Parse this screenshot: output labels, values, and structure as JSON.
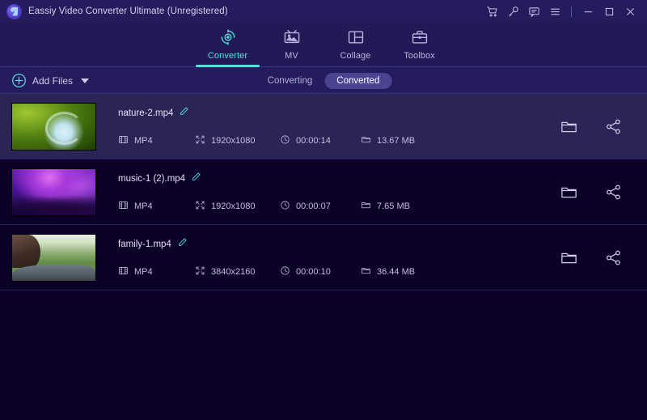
{
  "window": {
    "title": "Eassiy Video Converter Ultimate (Unregistered)",
    "logo_icon": "eassiy-logo-icon",
    "controls": [
      {
        "name": "cart-icon",
        "label": "Cart"
      },
      {
        "name": "key-icon",
        "label": "Register"
      },
      {
        "name": "feedback-icon",
        "label": "Feedback"
      },
      {
        "name": "menu-icon",
        "label": "Menu"
      },
      {
        "name": "minimize-icon",
        "label": "Minimize"
      },
      {
        "name": "maximize-icon",
        "label": "Maximize"
      },
      {
        "name": "close-icon",
        "label": "Close"
      }
    ]
  },
  "nav": {
    "tabs": [
      {
        "label": "Converter",
        "icon": "converter-icon",
        "active": true
      },
      {
        "label": "MV",
        "icon": "mv-icon",
        "active": false
      },
      {
        "label": "Collage",
        "icon": "collage-icon",
        "active": false
      },
      {
        "label": "Toolbox",
        "icon": "toolbox-icon",
        "active": false
      }
    ],
    "accent_color": "#4fe3da"
  },
  "toolbar": {
    "add_files_label": "Add Files",
    "add_files_icon": "plus-circle-icon",
    "dropdown_icon": "chevron-down-icon",
    "segments": [
      {
        "label": "Converting",
        "selected": false
      },
      {
        "label": "Converted",
        "selected": true
      }
    ]
  },
  "file_list": {
    "rows": [
      {
        "name": "nature-2.mp4",
        "format": "MP4",
        "resolution": "1920x1080",
        "duration": "00:00:14",
        "size": "13.67 MB",
        "thumbnail": "nature-canopy-thumbnail",
        "selected": true
      },
      {
        "name": "music-1 (2).mp4",
        "format": "MP4",
        "resolution": "1920x1080",
        "duration": "00:00:07",
        "size": "7.65 MB",
        "thumbnail": "concert-crowd-thumbnail",
        "selected": false
      },
      {
        "name": "family-1.mp4",
        "format": "MP4",
        "resolution": "3840x2160",
        "duration": "00:00:10",
        "size": "36.44 MB",
        "thumbnail": "family-park-thumbnail",
        "selected": false
      }
    ],
    "row_icons": {
      "edit": "edit-pencil-icon",
      "format": "film-strip-icon",
      "resolution": "resize-frame-icon",
      "duration": "clock-icon",
      "size": "folder-small-icon",
      "open_folder": "folder-icon",
      "share": "share-icon"
    }
  },
  "theme": {
    "window_bg": "#241c5c",
    "nav_bg": "#221a56",
    "list_bg": "#0a0028",
    "row_selected_bg": "#2b2457",
    "accent": "#4fe3da",
    "segment_on_bg": "#4b4490"
  }
}
